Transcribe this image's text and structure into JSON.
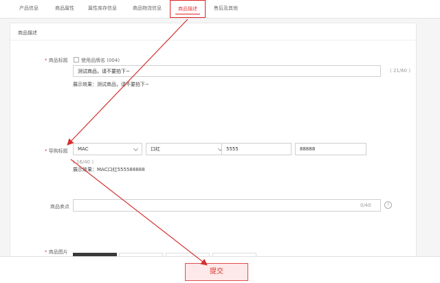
{
  "tabs": [
    {
      "label": "产品信息"
    },
    {
      "label": "商品属性"
    },
    {
      "label": "属性库存信息"
    },
    {
      "label": "商品物流信息"
    },
    {
      "label": "商品描述"
    },
    {
      "label": "售后及其他"
    }
  ],
  "section": {
    "title": "商品描述"
  },
  "title_field": {
    "label": "商品标题",
    "brand_option": "使用品牌名 (004)",
    "value": "测试商品，请不要拍下~",
    "counter": "( 21/60 )",
    "preview": "展示效果：测试商品，请不要拍下~"
  },
  "attr_field": {
    "label": "导购标题",
    "select1": "MAC",
    "select2": "口红",
    "input1": "5555",
    "input2": "88888",
    "counter": "( 16/40 )",
    "preview": "展示效果：MAC口红555588888"
  },
  "selling_field": {
    "label": "商品卖点",
    "counter": "0/40"
  },
  "images_field": {
    "label": "商品图片"
  },
  "submit": {
    "label": "提交"
  },
  "colors": {
    "accent": "#e4393c",
    "annotation": "#d32f2f"
  }
}
